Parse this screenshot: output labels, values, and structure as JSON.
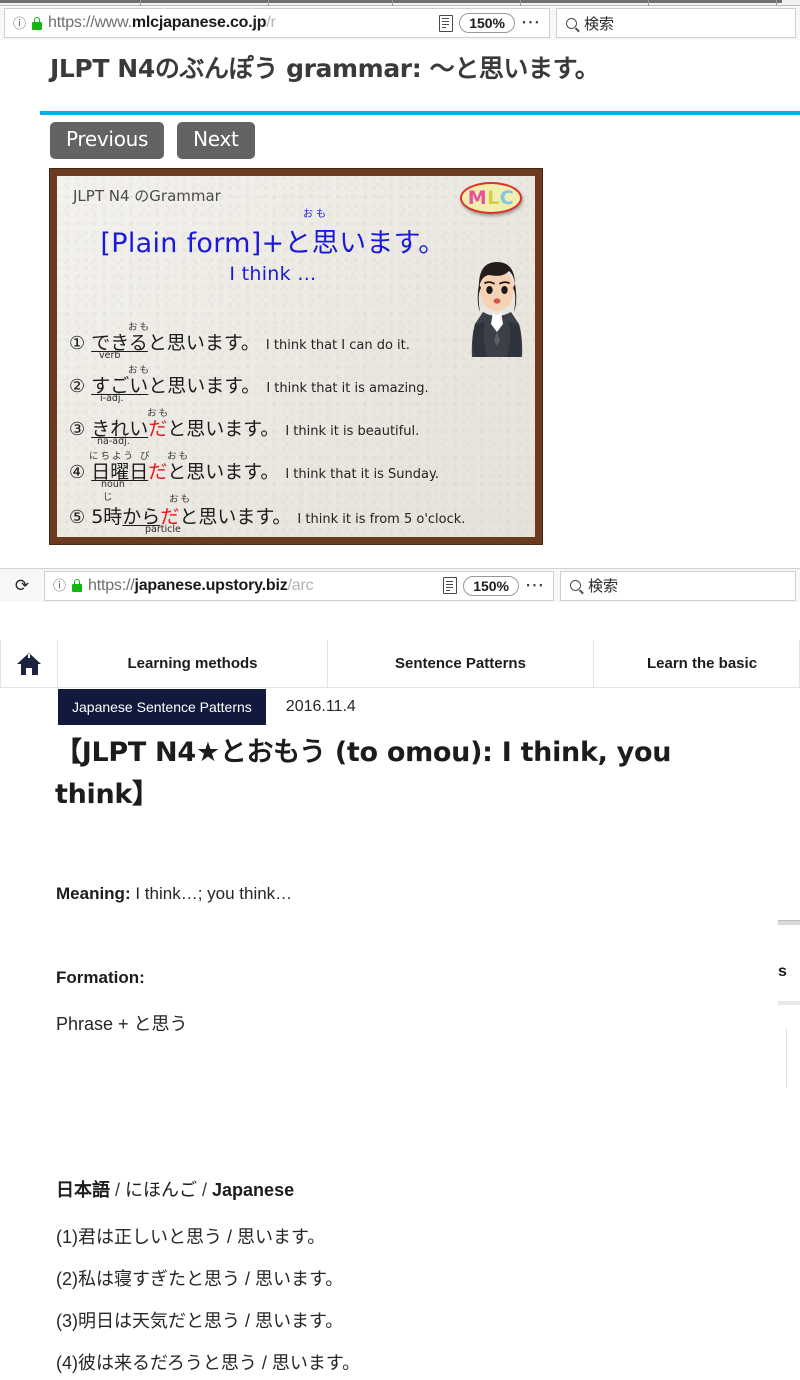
{
  "window_top": {
    "urlbar": {
      "info_icon": "info-icon",
      "lock_icon": "lock-icon",
      "url_prefix": "https://www.",
      "url_host": "mlcjapanese.co.jp",
      "url_suffix": "/r",
      "reader_icon": "reader-view-icon",
      "zoom_level": "150%",
      "menu_icon": "page-actions-icon",
      "search_icon": "search-icon",
      "search_placeholder": "検索"
    },
    "page": {
      "title": "JLPT N4のぶんぽう grammar: ～と思います。",
      "prev_label": "Previous",
      "next_label": "Next",
      "card": {
        "header": "JLPT N4 のGrammar",
        "logo": {
          "m": "M",
          "l": "L",
          "c": "C"
        },
        "ruby_top": "おも",
        "formula": "[Plain form]+と思います。",
        "formula_sub": "I think …",
        "illustration": "worried-woman-illustration",
        "examples": [
          {
            "num": "①",
            "ruby": "おも",
            "underlined": "できる",
            "red": "",
            "rest": "と思います。",
            "english": "I think that I can do it.",
            "label": "verb"
          },
          {
            "num": "②",
            "ruby": "おも",
            "underlined": "すごい",
            "red": "",
            "rest": "と思います。",
            "english": "I think that it is amazing.",
            "label": "i-adj."
          },
          {
            "num": "③",
            "ruby": "おも",
            "underlined": "きれい",
            "red": "だ",
            "rest": "と思います。",
            "english": "I think it is beautiful.",
            "label": "na-adj."
          },
          {
            "num": "④",
            "ruby": "にちよう び",
            "underlined": "日曜日",
            "red": "だ",
            "rest": "と思います。",
            "english": "I think that it is Sunday.",
            "label": "noun"
          },
          {
            "num": "⑤",
            "ruby_small": "じ",
            "ruby": "おも",
            "prefix": "5時",
            "underlined": "から",
            "red": "だ",
            "rest": "と思います。",
            "english": "I think it is from 5 o'clock.",
            "label": "particle"
          }
        ]
      }
    }
  },
  "window_bottom": {
    "urlbar": {
      "reload_icon": "reload-icon",
      "info_icon": "info-icon",
      "lock_icon": "lock-icon",
      "url_prefix": "https://",
      "url_host": "japanese.upstory.biz",
      "url_suffix": "/arc",
      "reader_icon": "reader-view-icon",
      "zoom_level": "150%",
      "menu_icon": "page-actions-icon",
      "search_icon": "search-icon",
      "search_placeholder": "検索"
    },
    "site_nav": {
      "home_icon": "home-icon",
      "items": [
        "Learning methods",
        "Sentence Patterns",
        "Learn the basic"
      ]
    },
    "category_badge": "Japanese Sentence Patterns",
    "date": "2016.11.4",
    "post_title": "【JLPT N4★とおもう (to omou): I think, you think】",
    "meaning_label": "Meaning:",
    "meaning_text": " I think…; you think…",
    "formation_label": "Formation:",
    "formation_text": "Phrase + と思う",
    "japanese_heading_jp": "日本語",
    "japanese_heading_sep": " / ",
    "japanese_heading_kana": "にほんご",
    "japanese_heading_en": "Japanese",
    "sentences": [
      "(1)君は正しいと思う / 思います。",
      "(2)私は寝すぎたと思う / 思います。",
      "(3)明日は天気だと思う / 思います。",
      "(4)彼は来るだろうと思う / 思います。"
    ],
    "side_peek_text": "s"
  }
}
